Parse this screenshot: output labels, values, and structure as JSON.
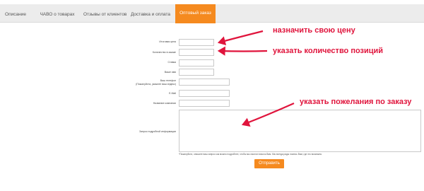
{
  "tabs": [
    {
      "label": "Описание"
    },
    {
      "label": "ЧАВО о товарах"
    },
    {
      "label": "Отзывы от клиентов"
    },
    {
      "label": "Доставка и оплата"
    },
    {
      "label": "Оптовый заказ"
    }
  ],
  "form": {
    "fields": [
      {
        "label": "Итоговая цена"
      },
      {
        "label": "Количество в заказе"
      },
      {
        "label": "Ставка"
      },
      {
        "label": "Ваше имя"
      },
      {
        "label_line1": "Ваш телефон",
        "label_line2": "(Пожалуйста, укажите ваш индекс)"
      },
      {
        "label": "E-Mail"
      },
      {
        "label": "Название компании"
      },
      {
        "label": "Запрос подробной информации"
      }
    ],
    "note": "*Пожалуйста, опишите ваш запрос как можно подробнее, чтобы мы смогли помочь Вам. Мы всегда рады помочь Вам, где это возможно.",
    "submit_label": "Отправить"
  },
  "annotations": {
    "price": "назначить свою цену",
    "quantity": "указать количество позиций",
    "wishes": "указать пожелания по заказу",
    "color": "#e0143c"
  },
  "colors": {
    "accent": "#f58a1f"
  }
}
